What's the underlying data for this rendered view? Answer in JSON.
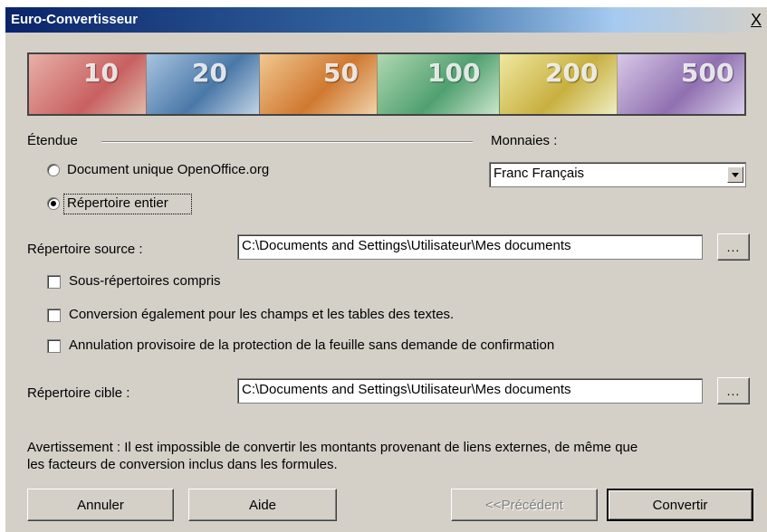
{
  "window": {
    "title": "Euro-Convertisseur",
    "close_label": "X"
  },
  "banner": {
    "notes": [
      "10",
      "20",
      "50",
      "100",
      "200",
      "500"
    ],
    "colors": [
      "#d98a80",
      "#7ea6c8",
      "#e0a060",
      "#8cc08c",
      "#d8c870",
      "#b8a0c8"
    ]
  },
  "scope": {
    "group_label": "Étendue",
    "options": [
      {
        "label": "Document unique OpenOffice.org",
        "selected": false
      },
      {
        "label": "Répertoire entier",
        "selected": true
      }
    ]
  },
  "currency": {
    "label": "Monnaies :",
    "value": "Franc Français"
  },
  "source": {
    "label": "Répertoire source :",
    "path": "C:\\Documents and Settings\\Utilisateur\\Mes documents",
    "browse_label": "..."
  },
  "options": [
    {
      "label": "Sous-répertoires compris",
      "checked": false
    },
    {
      "label": "Conversion également pour les champs et les tables des textes.",
      "checked": false
    },
    {
      "label": "Annulation provisoire de la protection de la feuille sans demande de confirmation",
      "checked": false
    }
  ],
  "target": {
    "label": "Répertoire cible :",
    "path": "C:\\Documents and Settings\\Utilisateur\\Mes documents",
    "browse_label": "..."
  },
  "warning": {
    "line1": "Avertissement : Il est impossible de convertir les montants provenant de liens externes, de même que",
    "line2": "les facteurs de conversion inclus dans les formules."
  },
  "buttons": {
    "cancel": "Annuler",
    "help": "Aide",
    "previous": "<<Précédent",
    "convert": "Convertir"
  }
}
